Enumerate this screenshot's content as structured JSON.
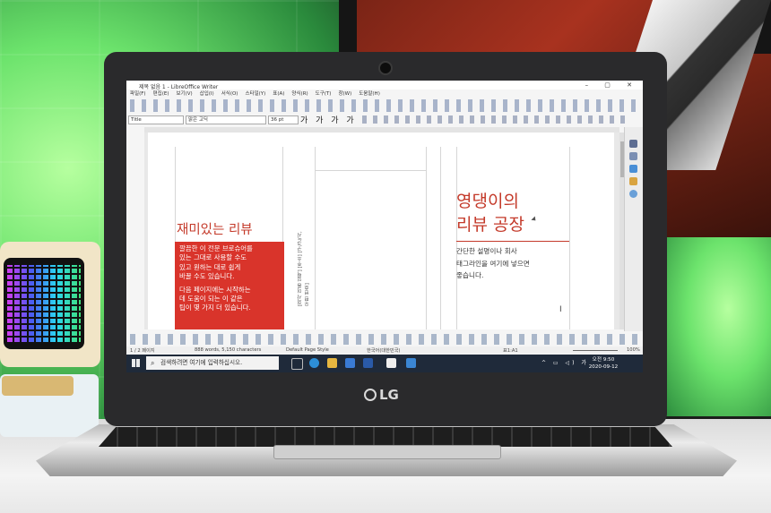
{
  "window": {
    "title": "제목 없음 1 - LibreOffice Writer",
    "controls": "–  ▢  ✕"
  },
  "menu": [
    "파일(F)",
    "편집(E)",
    "보기(V)",
    "삽입(I)",
    "서식(O)",
    "스타일(Y)",
    "표(A)",
    "양식(R)",
    "도구(T)",
    "창(W)",
    "도움말(H)"
  ],
  "format_bar": {
    "paragraph_style": "Title",
    "font_name": "맑은 고딕",
    "font_size": "36 pt",
    "buttons": "가 가 가 가"
  },
  "document": {
    "left_heading": "재미있는 리뷰",
    "left_box_lines": [
      "깔끔한 이 전문 브로슈어를",
      "있는 그대로 사용할 수도",
      "있고 원하는 대로 쉽게",
      "바꿀 수도 있습니다.",
      "다음 페이지에는 시작하는",
      "데 도움이 되는 이 같은",
      "팁이 몇 가지 더 있습니다."
    ],
    "vertical_text": "[회사 이름 입력] [주소] [구/군/시, 우편 번호]",
    "right_heading_lines": [
      "영댕이의",
      "리뷰 공장"
    ],
    "right_body_lines": [
      "간단한 설명이나 회사",
      "태그라인을 여기에 넣으면",
      "좋습니다."
    ]
  },
  "status_bar": {
    "page": "1 / 2 페이지",
    "words": "888 words, 5,150 characters",
    "page_style": "Default Page Style",
    "language": "한국어(대한민국)",
    "cell": "표1:A1",
    "zoom": "100%"
  },
  "taskbar": {
    "search_placeholder": "검색하려면 여기에 입력하십시오.",
    "tray": "^ ▭ ◁) 가",
    "time": "오전 9:50",
    "date": "2020-09-12"
  },
  "brand": "LG",
  "colors": {
    "accent_red": "#d9342b",
    "screen_bg": "#f5f5f5",
    "taskbar": "#1f2a3a",
    "wall_glow": "#6ce36c"
  }
}
